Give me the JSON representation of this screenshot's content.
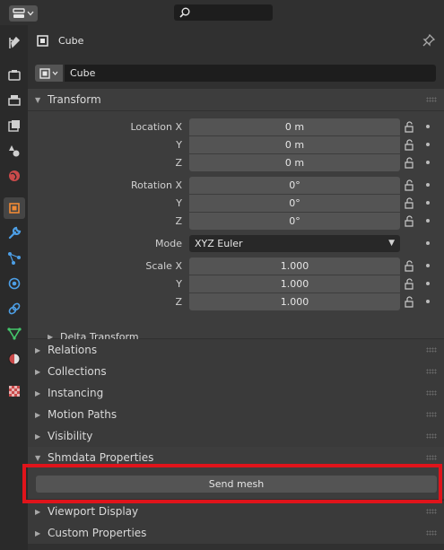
{
  "header": {
    "editor_type_icon": "properties-editor-icon",
    "search_placeholder": ""
  },
  "tabs": [
    {
      "name": "tool",
      "icon": "tool-icon"
    },
    {
      "name": "render",
      "icon": "render-icon"
    },
    {
      "name": "output",
      "icon": "output-icon"
    },
    {
      "name": "view-layer",
      "icon": "view-layer-icon"
    },
    {
      "name": "scene",
      "icon": "scene-icon"
    },
    {
      "name": "world",
      "icon": "world-icon"
    },
    {
      "name": "object",
      "icon": "object-icon",
      "active": true
    },
    {
      "name": "modifiers",
      "icon": "wrench-icon"
    },
    {
      "name": "particles",
      "icon": "particles-icon"
    },
    {
      "name": "physics",
      "icon": "physics-icon"
    },
    {
      "name": "constraints",
      "icon": "constraints-icon"
    },
    {
      "name": "data",
      "icon": "mesh-data-icon"
    },
    {
      "name": "material",
      "icon": "material-icon"
    },
    {
      "name": "texture",
      "icon": "texture-icon"
    }
  ],
  "object": {
    "title": "Cube",
    "name": "Cube"
  },
  "transform": {
    "label": "Transform",
    "location": {
      "label": "Location X",
      "y_label": "Y",
      "z_label": "Z",
      "x": "0 m",
      "y": "0 m",
      "z": "0 m"
    },
    "rotation": {
      "label": "Rotation X",
      "y_label": "Y",
      "z_label": "Z",
      "x": "0°",
      "y": "0°",
      "z": "0°"
    },
    "mode": {
      "label": "Mode",
      "value": "XYZ Euler"
    },
    "scale": {
      "label": "Scale X",
      "y_label": "Y",
      "z_label": "Z",
      "x": "1.000",
      "y": "1.000",
      "z": "1.000"
    },
    "delta": "Delta Transform"
  },
  "panels": {
    "relations": "Relations",
    "collections": "Collections",
    "instancing": "Instancing",
    "motion_paths": "Motion Paths",
    "visibility": "Visibility",
    "shmdata": "Shmdata Properties",
    "viewport_display": "Viewport Display",
    "custom_properties": "Custom Properties"
  },
  "shmdata": {
    "send_mesh": "Send mesh"
  },
  "colors": {
    "highlight": "#e0141b",
    "active_tab": "#f08a35",
    "background": "#303030"
  }
}
